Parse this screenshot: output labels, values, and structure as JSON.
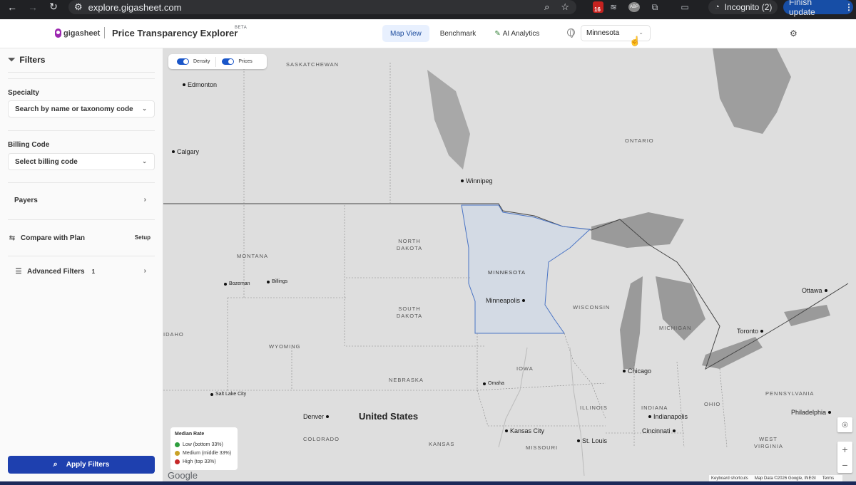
{
  "browser": {
    "url": "explore.gigasheet.com",
    "incognito_label": "Incognito (2)",
    "finish_update_label": "Finish update",
    "extension_badge": "16",
    "abp_label": "ABP"
  },
  "app": {
    "logo_text": "gigasheet",
    "title": "Price Transparency Explorer",
    "beta": "BETA",
    "tabs": [
      {
        "label": "Map View",
        "active": true
      },
      {
        "label": "Benchmark",
        "active": false
      },
      {
        "label": "AI Analytics",
        "active": false
      }
    ],
    "state_selected": "Minnesota"
  },
  "sidebar": {
    "title": "Filters",
    "specialty_label": "Specialty",
    "specialty_placeholder": "Search by name or taxonomy code",
    "billing_label": "Billing Code",
    "billing_placeholder": "Select billing code",
    "payers_label": "Payers",
    "compare_label": "Compare with Plan",
    "compare_action": "Setup",
    "advanced_label": "Advanced Filters",
    "advanced_count": "1",
    "apply_label": "Apply Filters"
  },
  "map": {
    "toggles": [
      {
        "label": "Density",
        "on": true
      },
      {
        "label": "Prices",
        "on": true
      }
    ],
    "legend": {
      "title": "Median Rate",
      "items": [
        {
          "label": "Low (bottom 33%)",
          "color": "#2e9e3e"
        },
        {
          "label": "Medium (middle 33%)",
          "color": "#c9a227"
        },
        {
          "label": "High (top 33%)",
          "color": "#c62828"
        }
      ]
    },
    "google_logo": "Google",
    "attribution": {
      "shortcuts": "Keyboard shortcuts",
      "data": "Map Data ©2026 Google, INEGI",
      "terms": "Terms"
    },
    "country_label": "United States",
    "regions": [
      "SASKATCHEWAN",
      "ONTARIO",
      "NORTH DAKOTA",
      "MONTANA",
      "MINNESOTA",
      "SOUTH DAKOTA",
      "WISCONSIN",
      "MICHIGAN",
      "IDAHO",
      "WYOMING",
      "IOWA",
      "NEBRASKA",
      "ILLINOIS",
      "INDIANA",
      "OHIO",
      "PENNSYLVANIA",
      "COLORADO",
      "KANSAS",
      "MISSOURI",
      "WEST VIRGINIA"
    ],
    "cities": [
      "Edmonton",
      "Calgary",
      "Winnipeg",
      "Minneapolis",
      "Ottawa",
      "Toronto",
      "Chicago",
      "Bozeman",
      "Billings",
      "Omaha",
      "Salt Lake City",
      "Denver",
      "Indianapolis",
      "Philadelphia",
      "Kansas City",
      "Cincinnati",
      "St. Louis"
    ]
  }
}
